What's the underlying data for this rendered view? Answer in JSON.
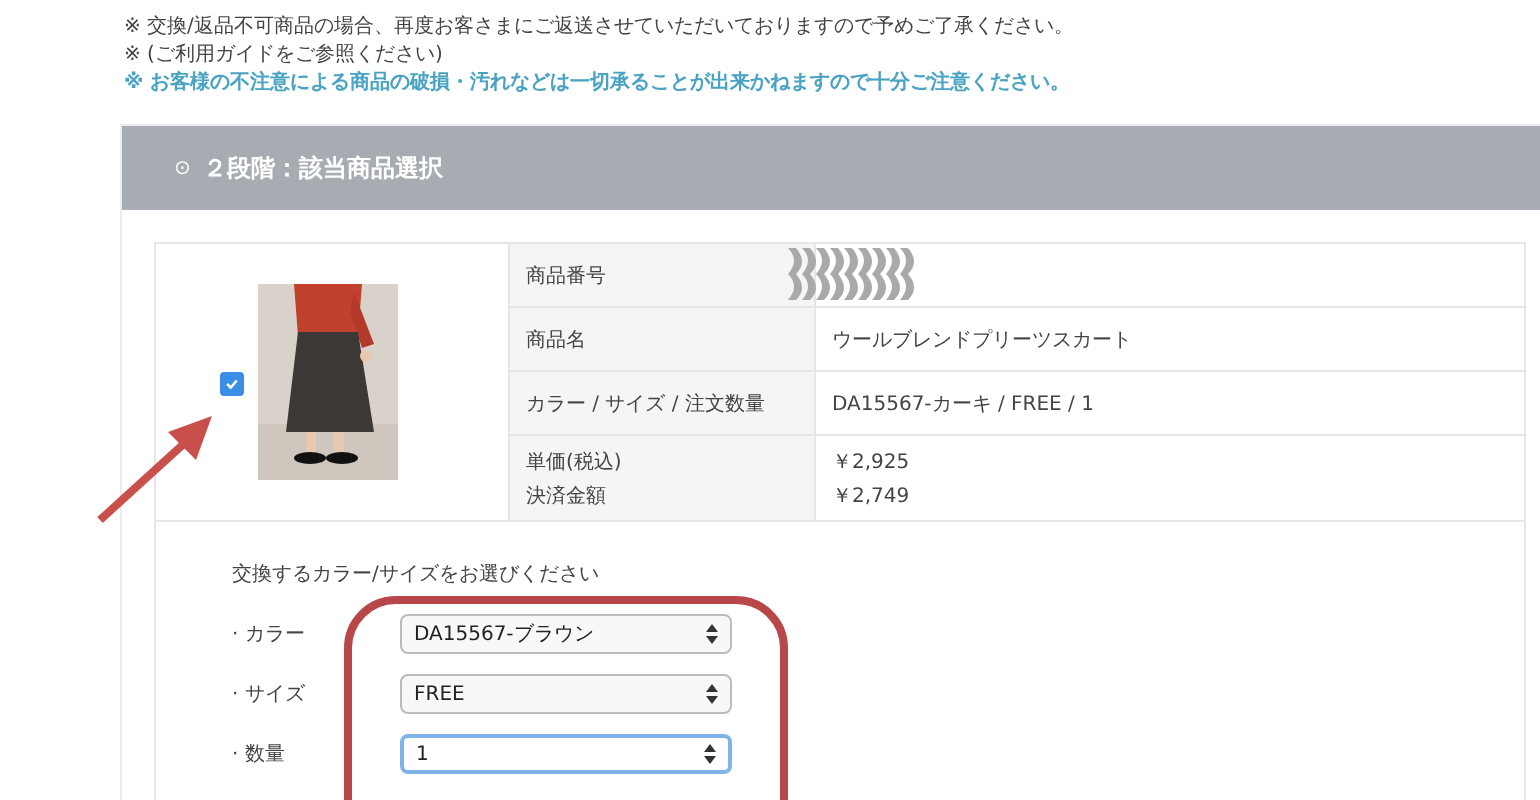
{
  "notes": [
    {
      "text": "※ 交換/返品不可商品の場合、再度お客さまにご返送させていただいておりますので予めご了承ください。",
      "kind": "plain"
    },
    {
      "text": "※ (ご利用ガイドをご参照ください)",
      "kind": "plain"
    },
    {
      "text": "※ お客様の不注意による商品の破損・汚れなどは一切承ることが出来かねますので十分ご注意ください。",
      "kind": "warning"
    }
  ],
  "section": {
    "icon": "⊙",
    "title": "２段階：該当商品選択"
  },
  "item": {
    "checked": true,
    "details": [
      {
        "label": "商品番号",
        "kind": "redacted"
      },
      {
        "label": "商品名",
        "value": "ウールブレンドプリーツスカート",
        "kind": "text"
      },
      {
        "label": "カラー / サイズ / 注文数量",
        "value": "DA15567-カーキ / FREE / 1",
        "kind": "text"
      },
      {
        "label": "単価(税込)",
        "label2": "決済金額",
        "value": "￥2,925",
        "value2": "￥2,749",
        "kind": "price"
      }
    ]
  },
  "exchange": {
    "prompt": "交換するカラー/サイズをお選びください",
    "fields": [
      {
        "label": "· カラー",
        "value": "DA15567-ブラウン",
        "focused": false
      },
      {
        "label": "· サイズ",
        "value": "FREE",
        "focused": false
      },
      {
        "label": "· 数量",
        "value": "1",
        "focused": true
      }
    ]
  }
}
